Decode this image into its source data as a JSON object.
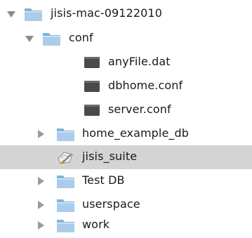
{
  "tree": {
    "root": {
      "label": "jisis-mac-09122010",
      "icon": "folder-icon",
      "expanded": true
    },
    "conf": {
      "label": "conf",
      "icon": "folder-icon",
      "expanded": true
    },
    "files": [
      {
        "label": "anyFile.dat",
        "icon": "document-icon"
      },
      {
        "label": "dbhome.conf",
        "icon": "document-icon"
      },
      {
        "label": "server.conf",
        "icon": "document-icon"
      }
    ],
    "home_example_db": {
      "label": "home_example_db",
      "icon": "folder-icon",
      "expanded": false
    },
    "jisis_suite": {
      "label": "jisis_suite",
      "icon": "application-icon",
      "selected": true
    },
    "test_db": {
      "label": "Test DB",
      "icon": "folder-icon",
      "expanded": false
    },
    "userspace": {
      "label": "userspace",
      "icon": "folder-icon",
      "expanded": false
    },
    "work": {
      "label": "work",
      "icon": "folder-icon",
      "expanded": false
    }
  },
  "colors": {
    "selection": "#d4d4d4",
    "folder_tab": "#7fb4dd",
    "folder_body": "#a9cdea",
    "document": "#4a4a4a"
  }
}
